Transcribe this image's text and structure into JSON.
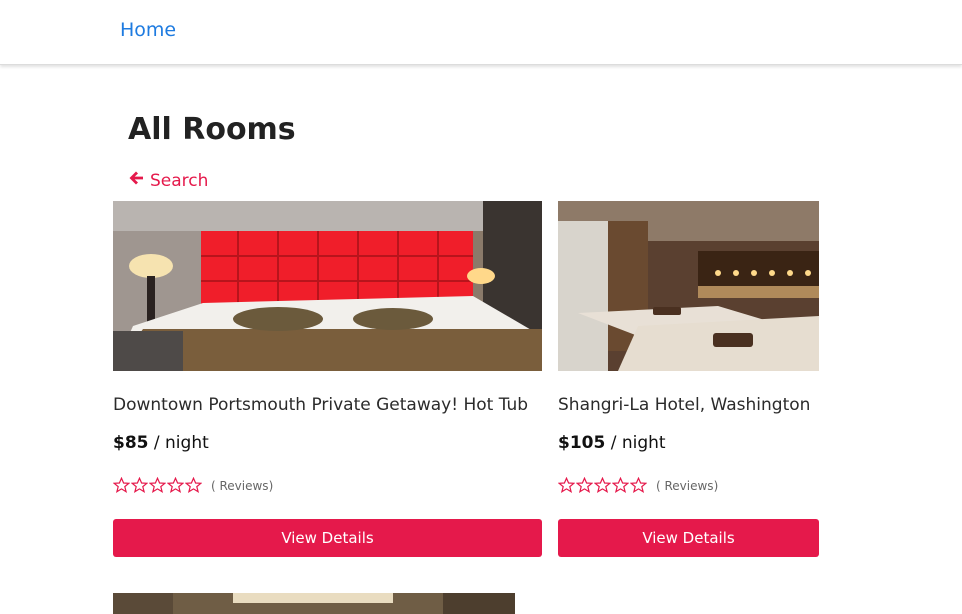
{
  "nav": {
    "home_label": "Home"
  },
  "page": {
    "title": "All Rooms",
    "back_label": "Search"
  },
  "rooms": [
    {
      "name": "Downtown Portsmouth Private Getaway! Hot Tub",
      "price": "$85",
      "price_unit": " / night",
      "reviews": "( Reviews)",
      "rating": 0,
      "button_label": "View Details"
    },
    {
      "name": "Shangri-La Hotel, Washington",
      "price": "$105",
      "price_unit": " / night",
      "reviews": "( Reviews)",
      "rating": 0,
      "button_label": "View Details"
    }
  ],
  "colors": {
    "accent": "#e5194b",
    "link": "#1e7be0"
  },
  "icons": {
    "back": "arrow-left-icon",
    "star": "star-outline-icon"
  }
}
